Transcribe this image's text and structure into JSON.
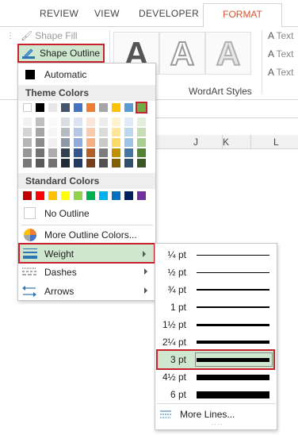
{
  "tabs": {
    "review": "REVIEW",
    "view": "VIEW",
    "developer": "DEVELOPER",
    "format": "FORMAT"
  },
  "ribbon": {
    "shape_fill": "Shape Fill",
    "shape_outline": "Shape Outline",
    "wordart_letter": "A",
    "wordart_group": "WordArt Styles",
    "text_fill": "Text",
    "text_outline": "Text",
    "text_effects": "Text"
  },
  "columns": [
    "J",
    "K",
    "L"
  ],
  "menu": {
    "automatic": "Automatic",
    "theme_colors_header": "Theme Colors",
    "standard_colors_header": "Standard Colors",
    "no_outline": "No Outline",
    "more_colors": "More Outline Colors...",
    "weight": "Weight",
    "dashes": "Dashes",
    "arrows": "Arrows"
  },
  "theme_row1": [
    "#ffffff",
    "#000000",
    "#e7e6e6",
    "#44546a",
    "#4472c4",
    "#ed7d31",
    "#a5a5a5",
    "#ffc000",
    "#5b9bd5",
    "#70ad47"
  ],
  "standard_colors": [
    "#c00000",
    "#ff0000",
    "#ffc000",
    "#ffff00",
    "#92d050",
    "#00b050",
    "#00b0f0",
    "#0070c0",
    "#002060",
    "#7030a0"
  ],
  "weights": [
    {
      "label": "¼ pt"
    },
    {
      "label": "½ pt"
    },
    {
      "label": "¾ pt"
    },
    {
      "label": "1 pt"
    },
    {
      "label": "1½ pt"
    },
    {
      "label": "2¼ pt"
    },
    {
      "label": "3 pt",
      "selected": true
    },
    {
      "label": "4½ pt"
    },
    {
      "label": "6 pt"
    }
  ],
  "more_lines": "More Lines..."
}
